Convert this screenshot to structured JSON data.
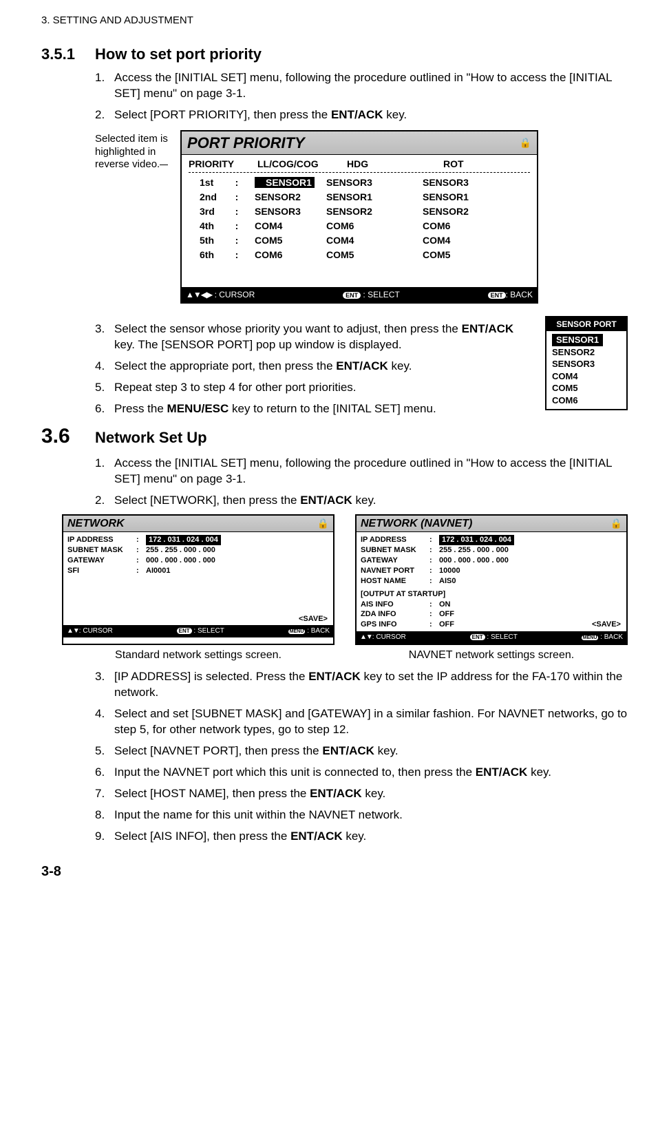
{
  "chapter": "3.  SETTING AND ADJUSTMENT",
  "sec351": {
    "num": "3.5.1",
    "title": "How to set port priority"
  },
  "steps351": {
    "s1n": "1.",
    "s1": "Access the [INITIAL SET] menu, following the procedure outlined in \"How to access the [INITIAL SET] menu\" on page 3-1.",
    "s2n": "2.",
    "s2a": "Select [PORT PRIORITY], then press the ",
    "s2b": "ENT/ACK",
    "s2c": " key."
  },
  "fig1": {
    "note": "Selected item is highlighted in reverse video.",
    "title": "PORT PRIORITY",
    "hdr": {
      "c1": "PRIORITY",
      "c2": "LL/COG/COG",
      "c3": "HDG",
      "c4": "ROT"
    },
    "rows": [
      {
        "p": "1st",
        "ll": "SENSOR1",
        "hdg": "SENSOR3",
        "rot": "SENSOR3"
      },
      {
        "p": "2nd",
        "ll": "SENSOR2",
        "hdg": "SENSOR1",
        "rot": "SENSOR1"
      },
      {
        "p": "3rd",
        "ll": "SENSOR3",
        "hdg": "SENSOR2",
        "rot": "SENSOR2"
      },
      {
        "p": "4th",
        "ll": "COM4",
        "hdg": "COM6",
        "rot": "COM6"
      },
      {
        "p": "5th",
        "ll": "COM5",
        "hdg": "COM4",
        "rot": "COM4"
      },
      {
        "p": "6th",
        "ll": "COM6",
        "hdg": "COM5",
        "rot": "COM5"
      }
    ],
    "footer": {
      "cursor": ": CURSOR",
      "select": ": SELECT",
      "back": ": BACK",
      "ent": "ENT"
    }
  },
  "popup": {
    "title": "SENSOR PORT",
    "items": [
      "SENSOR1",
      "SENSOR2",
      "SENSOR3",
      "COM4",
      "COM5",
      "COM6"
    ]
  },
  "steps351b": {
    "s3n": "3.",
    "s3a": "Select the sensor whose priority you want to adjust, then press the ",
    "s3b": "ENT/ACK",
    "s3c": " key. The [SENSOR PORT] pop up window is displayed.",
    "s4n": "4.",
    "s4a": "Select the appropriate port, then press the ",
    "s4b": "ENT/ACK",
    "s4c": " key.",
    "s5n": "5.",
    "s5": "Repeat step 3 to step 4 for other port priorities.",
    "s6n": "6.",
    "s6a": "Press the ",
    "s6b": "MENU/ESC",
    "s6c": " key to return to the [INITAL SET] menu."
  },
  "sec36": {
    "num": "3.6",
    "title": "Network Set Up"
  },
  "steps36": {
    "s1n": "1.",
    "s1": "Access the [INITIAL SET] menu, following the procedure outlined in \"How to access the [INITIAL SET] menu\" on page 3-1.",
    "s2n": "2.",
    "s2a": "Select [NETWORK], then press the ",
    "s2b": "ENT/ACK",
    "s2c": " key."
  },
  "netA": {
    "title": "NETWORK",
    "ip_lbl": "IP ADDRESS",
    "ip": "172 . 031 . 024 . 004",
    "mask_lbl": "SUBNET MASK",
    "mask": "255 . 255 . 000 . 000",
    "gw_lbl": "GATEWAY",
    "gw": "000 . 000 . 000 . 000",
    "sfi_lbl": "SFI",
    "sfi": "AI0001",
    "save": "<SAVE>"
  },
  "netB": {
    "title": "NETWORK  (NAVNET)",
    "ip_lbl": "IP ADDRESS",
    "ip": "172 . 031 . 024 . 004",
    "mask_lbl": "SUBNET MASK",
    "mask": "255 . 255 . 000 . 000",
    "gw_lbl": "GATEWAY",
    "gw": "000 . 000 . 000 . 000",
    "port_lbl": "NAVNET PORT",
    "port": "10000",
    "host_lbl": "HOST NAME",
    "host": "AIS0",
    "out_lbl": "[OUTPUT AT STARTUP]",
    "ais_lbl": "AIS INFO",
    "ais": "ON",
    "zda_lbl": "ZDA INFO",
    "zda": "OFF",
    "gps_lbl": "GPS INFO",
    "gps": "OFF",
    "save": "<SAVE>"
  },
  "netfooter": {
    "cursor": ": CURSOR",
    "select": ": SELECT",
    "back": ": BACK",
    "ent": "ENT",
    "menu": "MENU"
  },
  "captions": {
    "a": "Standard network settings screen.",
    "b": "NAVNET network settings screen."
  },
  "steps36b": {
    "s3n": "3.",
    "s3a": "[IP ADDRESS] is selected. Press the ",
    "s3b": "ENT/ACK",
    "s3c": " key to set the IP address for the FA-170 within the network.",
    "s4n": "4.",
    "s4": "Select and set [SUBNET MASK] and [GATEWAY] in a similar fashion. For NAVNET networks, go to step 5, for other network types, go to step 12.",
    "s5n": "5.",
    "s5a": "Select [NAVNET PORT], then press the ",
    "s5b": "ENT/ACK",
    "s5c": " key.",
    "s6n": "6.",
    "s6a": "Input the NAVNET port which this unit is connected to, then press the ",
    "s6b": "ENT/ACK",
    "s6c": " key.",
    "s7n": "7.",
    "s7a": "Select [HOST NAME], then press the ",
    "s7b": "ENT/ACK",
    "s7c": " key.",
    "s8n": "8.",
    "s8": "Input the name for this unit within the NAVNET network.",
    "s9n": "9.",
    "s9a": "Select [AIS INFO], then press the ",
    "s9b": "ENT/ACK",
    "s9c": " key."
  },
  "pagenum": "3-8",
  "lock": "🔒"
}
